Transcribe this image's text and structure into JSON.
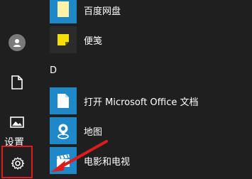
{
  "left_rail": {
    "tooltip": "设置",
    "items": [
      "user-avatar",
      "documents-icon",
      "pictures-icon",
      "settings-icon"
    ]
  },
  "apps": [
    {
      "label": "百度网盘",
      "tile_color": "#1e88c8"
    },
    {
      "label": "便笺",
      "tile_color": "#2b2b2b"
    },
    {
      "label": "打开 Microsoft Office 文档",
      "tile_color": "#1e88c8"
    },
    {
      "label": "地图",
      "tile_color": "#1e88c8"
    },
    {
      "label": "电影和电视",
      "tile_color": "#1e88c8"
    }
  ],
  "section_letter": "D",
  "colors": {
    "background": "#1f1f1f",
    "tile_blue": "#1e88c8",
    "highlight_red": "#e01b1b"
  }
}
